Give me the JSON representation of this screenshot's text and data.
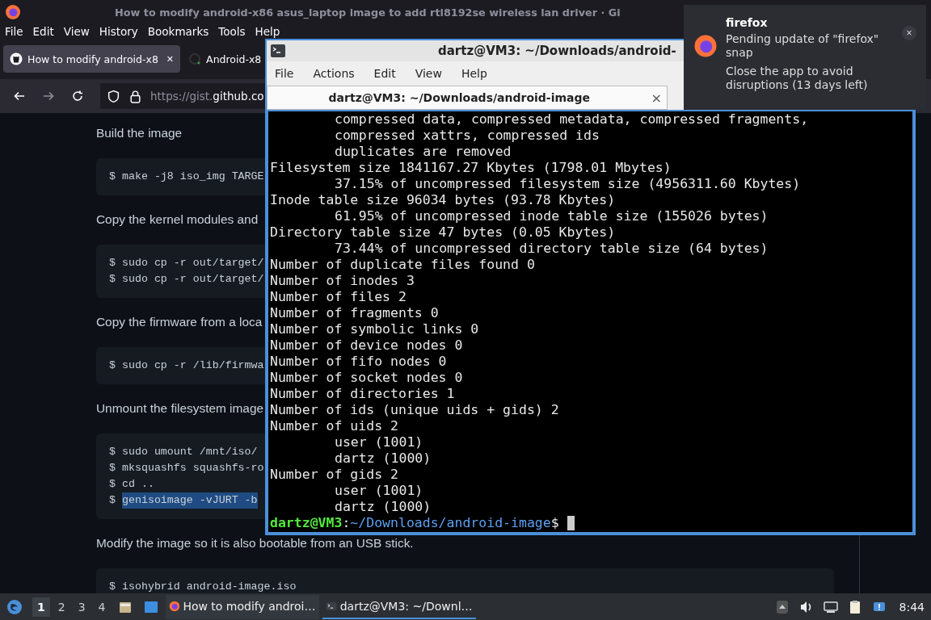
{
  "browser": {
    "title": "How to modify android-x86 asus_laptop image to add rtl8192se wireless lan driver · Gi",
    "menu": [
      {
        "label": "File"
      },
      {
        "label": "Edit"
      },
      {
        "label": "View"
      },
      {
        "label": "History"
      },
      {
        "label": "Bookmarks"
      },
      {
        "label": "Tools"
      },
      {
        "label": "Help"
      }
    ],
    "tabs": [
      {
        "label": "How to modify android-x8",
        "selected": true,
        "kind": "github",
        "close": "✕"
      },
      {
        "label": "Android-x8",
        "selected": false,
        "kind": "loading"
      }
    ],
    "url": {
      "scheme": "https://gist.",
      "host": "github.co"
    },
    "content": [
      {
        "kind": "text",
        "text": "Build the image"
      },
      {
        "kind": "code",
        "lines": [
          {
            "prompt": "$",
            "text": "make -j8 iso_img TARGE",
            "selected": false
          }
        ]
      },
      {
        "kind": "text",
        "text": "Copy the kernel modules and"
      },
      {
        "kind": "code",
        "lines": [
          {
            "prompt": "$",
            "text": "sudo cp -r out/target/",
            "selected": false
          },
          {
            "prompt": "$",
            "text": "sudo cp -r out/target/",
            "selected": false
          }
        ]
      },
      {
        "kind": "text",
        "text": "Copy the firmware from a loca"
      },
      {
        "kind": "code",
        "lines": [
          {
            "prompt": "$",
            "text": "sudo cp -r /lib/firmwa",
            "selected": false
          }
        ]
      },
      {
        "kind": "text",
        "text": "Unmount the filesystem image"
      },
      {
        "kind": "code",
        "lines": [
          {
            "prompt": "$",
            "text": "sudo umount /mnt/iso/",
            "selected": false
          },
          {
            "prompt": "$",
            "text": "mksquashfs squashfs-ro",
            "selected": false
          },
          {
            "prompt": "$",
            "text": "cd ..",
            "selected": false
          },
          {
            "prompt": "$",
            "text": "genisoimage -vJURT -b",
            "selected": true
          }
        ]
      },
      {
        "kind": "text",
        "text": "Modify the image so it is also bootable from an USB stick."
      },
      {
        "kind": "code",
        "lines": [
          {
            "prompt": "$",
            "text": "isohybrid android-image.iso",
            "selected": false
          }
        ]
      }
    ]
  },
  "terminal": {
    "title": "dartz@VM3: ~/Downloads/android-",
    "menu": [
      {
        "label": "File"
      },
      {
        "label": "Actions"
      },
      {
        "label": "Edit"
      },
      {
        "label": "View"
      },
      {
        "label": "Help"
      }
    ],
    "tab": {
      "label": "dartz@VM3: ~/Downloads/android-image",
      "close": "×"
    },
    "lines": [
      {
        "text": "compressed data, compressed metadata, compressed fragments,",
        "indent": true
      },
      {
        "text": "compressed xattrs, compressed ids",
        "indent": true
      },
      {
        "text": "duplicates are removed",
        "indent": true
      },
      {
        "text": "Filesystem size 1841167.27 Kbytes (1798.01 Mbytes)",
        "indent": false
      },
      {
        "text": "37.15% of uncompressed filesystem size (4956311.60 Kbytes)",
        "indent": true
      },
      {
        "text": "Inode table size 96034 bytes (93.78 Kbytes)",
        "indent": false
      },
      {
        "text": "61.95% of uncompressed inode table size (155026 bytes)",
        "indent": true
      },
      {
        "text": "Directory table size 47 bytes (0.05 Kbytes)",
        "indent": false
      },
      {
        "text": "73.44% of uncompressed directory table size (64 bytes)",
        "indent": true
      },
      {
        "text": "Number of duplicate files found 0",
        "indent": false
      },
      {
        "text": "Number of inodes 3",
        "indent": false
      },
      {
        "text": "Number of files 2",
        "indent": false
      },
      {
        "text": "Number of fragments 0",
        "indent": false
      },
      {
        "text": "Number of symbolic links 0",
        "indent": false
      },
      {
        "text": "Number of device nodes 0",
        "indent": false
      },
      {
        "text": "Number of fifo nodes 0",
        "indent": false
      },
      {
        "text": "Number of socket nodes 0",
        "indent": false
      },
      {
        "text": "Number of directories 1",
        "indent": false
      },
      {
        "text": "Number of ids (unique uids + gids) 2",
        "indent": false
      },
      {
        "text": "Number of uids 2",
        "indent": false
      },
      {
        "text": "user (1001)",
        "indent": true
      },
      {
        "text": "dartz (1000)",
        "indent": true
      },
      {
        "text": "Number of gids 2",
        "indent": false
      },
      {
        "text": "user (1001)",
        "indent": true
      },
      {
        "text": "dartz (1000)",
        "indent": true
      }
    ],
    "prompt": {
      "user_host": "dartz@VM3",
      "colon": ":",
      "path": "~/Downloads/android-image",
      "symbol": "$"
    }
  },
  "notification": {
    "app": "firefox",
    "close": "×",
    "message": "Pending update of \"firefox\" snap",
    "detail": "Close the app to avoid disruptions (13 days left)"
  },
  "taskbar": {
    "workspaces": [
      {
        "label": "1",
        "selected": true
      },
      {
        "label": "2",
        "selected": false
      },
      {
        "label": "3",
        "selected": false
      },
      {
        "label": "4",
        "selected": false
      }
    ],
    "tasks": [
      {
        "label": "How to modify androi…",
        "kind": "firefox",
        "selected": false
      },
      {
        "label": "dartz@VM3: ~/Downl…",
        "kind": "terminal",
        "selected": true
      }
    ],
    "clock": "8:44"
  }
}
